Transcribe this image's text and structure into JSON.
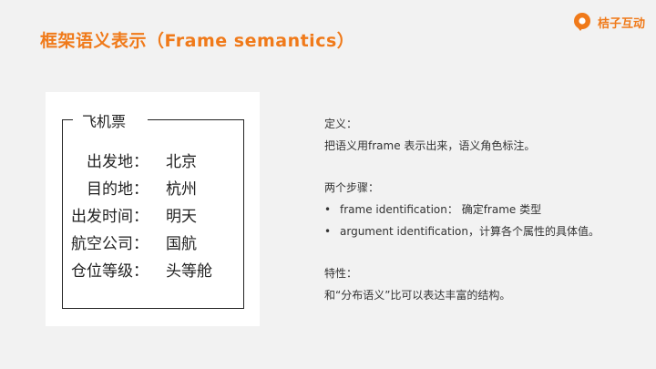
{
  "header": {
    "title": "框架语义表示（Frame semantics）",
    "logo_text": "桔子互动",
    "logo_icon": "location-pin-icon",
    "accent_color": "#f07a1a"
  },
  "ticket": {
    "title": "飞机票",
    "fields": [
      {
        "label": "出发地：",
        "value": "北京"
      },
      {
        "label": "目的地：",
        "value": "杭州"
      },
      {
        "label": "出发时间：",
        "value": "明天"
      },
      {
        "label": "航空公司：",
        "value": "国航"
      },
      {
        "label": "仓位等级：",
        "value": "头等舱"
      }
    ]
  },
  "definition": {
    "heading": "定义：",
    "text": "把语义用frame 表示出来，语义角色标注。"
  },
  "steps": {
    "heading": "两个步骤：",
    "items": [
      "frame identification： 确定frame 类型",
      "argument identification，计算各个属性的具体值。"
    ],
    "bullet_symbol": "•"
  },
  "features": {
    "heading": "特性：",
    "text": "和“分布语义”比可以表达丰富的结构。"
  }
}
